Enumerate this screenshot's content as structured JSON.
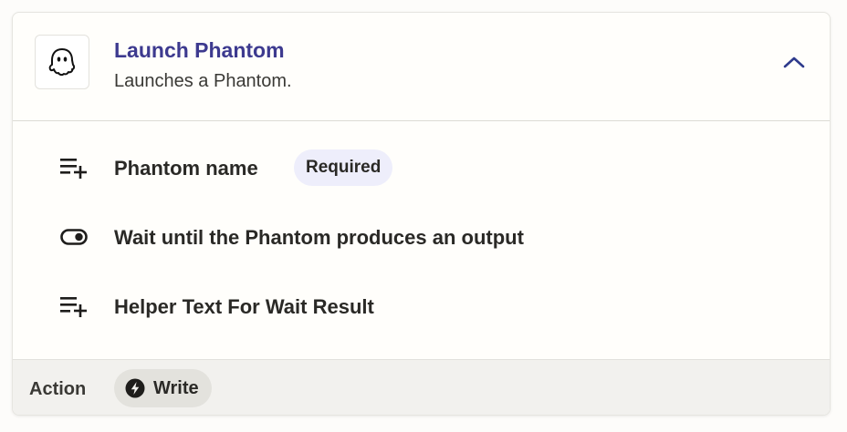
{
  "step": {
    "title": "Launch Phantom",
    "description": "Launches a Phantom.",
    "app_icon": "ghost-icon",
    "collapse_icon": "chevron-up-icon",
    "title_color": "#3d3a8f"
  },
  "fields": [
    {
      "label": "Phantom name",
      "icon": "list-add-icon",
      "badge": "Required"
    },
    {
      "label": "Wait until the Phantom produces an output",
      "icon": "toggle-icon"
    },
    {
      "label": "Helper Text For Wait Result",
      "icon": "list-add-icon"
    }
  ],
  "footer": {
    "type_label": "Action",
    "type_value": "Write",
    "type_icon": "bolt-icon"
  }
}
